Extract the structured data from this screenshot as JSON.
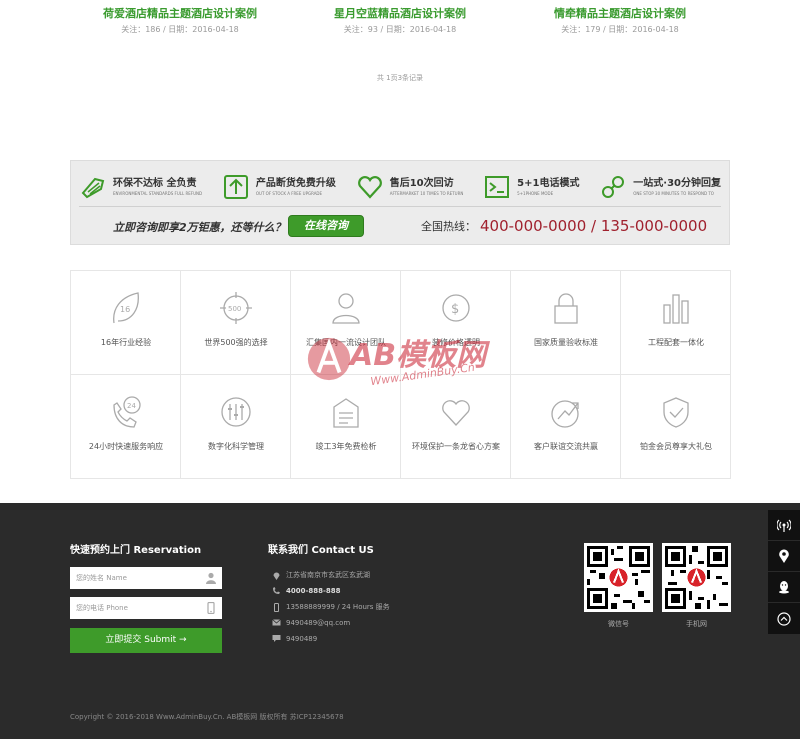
{
  "cases": [
    {
      "title": "荷爱酒店精品主题酒店设计案例",
      "meta": "关注：186 / 日期：2016-04-18"
    },
    {
      "title": "星月空蓝精品酒店设计案例",
      "meta": "关注：93 / 日期：2016-04-18"
    },
    {
      "title": "情牵精品主题酒店设计案例",
      "meta": "关注：179 / 日期：2016-04-18"
    }
  ],
  "pager": "共 1页3条记录",
  "banner": {
    "features": [
      {
        "icon": "eco-leaf-icon",
        "title": "环保不达标 全负责",
        "sub": "ENVIRONMENTAL STANDARDS FULL REFUND"
      },
      {
        "icon": "upgrade-arrow-icon",
        "title": "产品断货免费升级",
        "sub": "OUT OF STOCK A FREE UPGRADE"
      },
      {
        "icon": "heart-icon",
        "title": "售后10次回访",
        "sub": "AFTERMARKET 10 TIMES TO RETURN"
      },
      {
        "icon": "phone-mode-icon",
        "title": "5+1电话模式",
        "sub": "5+1PHONE MODE"
      },
      {
        "icon": "one-stop-icon",
        "title": "一站式·30分钟回复",
        "sub": "ONE STOP 30 MINUTES TO RESPOND TO"
      }
    ],
    "promo": "立即咨询即享2万钜惠，还等什么？",
    "button": "在线咨询",
    "hotline_label": "全国热线：",
    "hotline_numbers": "400-000-0000 / 135-000-0000"
  },
  "services": [
    {
      "icon": "leaf-16-icon",
      "label": "16年行业经验"
    },
    {
      "icon": "target-500-icon",
      "label": "世界500强的选择"
    },
    {
      "icon": "person-icon",
      "label": "汇集国内一流设计团队"
    },
    {
      "icon": "dollar-coin-icon",
      "label": "装修价格透明"
    },
    {
      "icon": "lock-icon",
      "label": "国家质量验收标准"
    },
    {
      "icon": "bar-chart-icon",
      "label": "工程配套一体化"
    },
    {
      "icon": "phone-24-icon",
      "label": "24小时快速服务响应"
    },
    {
      "icon": "sliders-icon",
      "label": "数字化科学管理"
    },
    {
      "icon": "document-icon",
      "label": "竣工3年免费检析"
    },
    {
      "icon": "heart-outline-icon",
      "label": "环境保护一条龙省心方案"
    },
    {
      "icon": "growth-arrow-icon",
      "label": "客户联谊交流共赢"
    },
    {
      "icon": "shield-check-icon",
      "label": "铂金会员尊享大礼包"
    }
  ],
  "watermark": {
    "logo": "AB模板网",
    "sub": "Www.AdminBuy.Cn"
  },
  "footer": {
    "reservation_title": "快速预约上门 Reservation",
    "name_placeholder": "您的姓名 Name",
    "phone_placeholder": "您的电话 Phone",
    "submit": "立即提交 Submit →",
    "contact_title": "联系我们 Contact US",
    "address": "江苏省南京市玄武区玄武湖",
    "hotline": "4000-888-888",
    "mobile": "13588889999 / 24 Hours 服务",
    "email": "9490489@qq.com",
    "qq": "9490489",
    "qr1_caption": "微信号",
    "qr2_caption": "手机网",
    "copyright": "Copyright © 2016-2018 Www.AdminBuy.Cn. AB模板网 版权所有 苏ICP12345678"
  },
  "sidebar": [
    "wireless-icon",
    "location-pin-icon",
    "qq-icon",
    "back-to-top-icon"
  ],
  "colors": {
    "accent_green": "#3e9b2a",
    "hotline_red": "#a0212e",
    "footer_bg": "#2b2b2b",
    "title_green": "#3a9b2f"
  }
}
